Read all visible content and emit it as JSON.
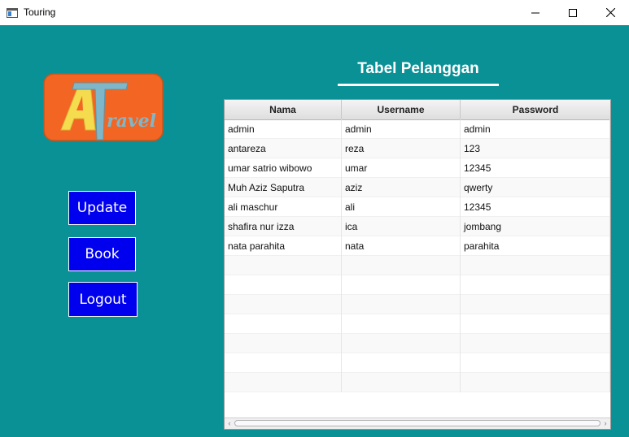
{
  "window": {
    "title": "Touring"
  },
  "colors": {
    "background": "#0a9196",
    "button": "#0000ee",
    "logo_bg": "#f26522",
    "logo_letters": "#f5dc4f"
  },
  "logo": {
    "icon": "at-travel-logo",
    "text": "ravel"
  },
  "sidebar": {
    "buttons": [
      {
        "label": "Update"
      },
      {
        "label": "Book"
      },
      {
        "label": "Logout"
      }
    ]
  },
  "main": {
    "heading": "Tabel Pelanggan",
    "table": {
      "columns": [
        "Nama",
        "Username",
        "Password"
      ],
      "rows": [
        [
          "admin",
          "admin",
          "admin"
        ],
        [
          "antareza",
          "reza",
          "123"
        ],
        [
          "umar satrio wibowo",
          "umar",
          "12345"
        ],
        [
          "Muh Aziz Saputra",
          "aziz",
          "qwerty"
        ],
        [
          "ali maschur",
          "ali",
          "12345"
        ],
        [
          "shafira nur izza",
          "ica",
          "jombang"
        ],
        [
          "nata parahita",
          "nata",
          "parahita"
        ]
      ]
    }
  }
}
